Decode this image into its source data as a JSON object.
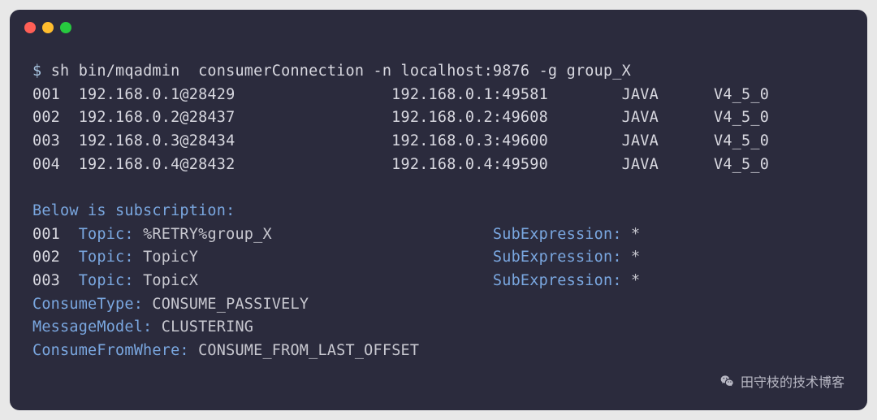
{
  "command": {
    "prompt": "$",
    "text": "sh bin/mqadmin  consumerConnection -n localhost:9876 -g group_X"
  },
  "connections": [
    {
      "idx": "001",
      "client": "192.168.0.1@28429",
      "addr": "192.168.0.1:49581",
      "lang": "JAVA",
      "ver": "V4_5_0"
    },
    {
      "idx": "002",
      "client": "192.168.0.2@28437",
      "addr": "192.168.0.2:49608",
      "lang": "JAVA",
      "ver": "V4_5_0"
    },
    {
      "idx": "003",
      "client": "192.168.0.3@28434",
      "addr": "192.168.0.3:49600",
      "lang": "JAVA",
      "ver": "V4_5_0"
    },
    {
      "idx": "004",
      "client": "192.168.0.4@28432",
      "addr": "192.168.0.4:49590",
      "lang": "JAVA",
      "ver": "V4_5_0"
    }
  ],
  "subscription": {
    "header": "Below is subscription:",
    "topic_label": "Topic:",
    "subexpr_label": "SubExpression:",
    "rows": [
      {
        "idx": "001",
        "topic": "%RETRY%group_X",
        "subexpr": "*"
      },
      {
        "idx": "002",
        "topic": "TopicY",
        "subexpr": "*"
      },
      {
        "idx": "003",
        "topic": "TopicX",
        "subexpr": "*"
      }
    ],
    "meta": [
      {
        "key": "ConsumeType:",
        "value": "CONSUME_PASSIVELY"
      },
      {
        "key": "MessageModel:",
        "value": "CLUSTERING"
      },
      {
        "key": "ConsumeFromWhere:",
        "value": "CONSUME_FROM_LAST_OFFSET"
      }
    ]
  },
  "watermark": "田守枝的技术博客"
}
